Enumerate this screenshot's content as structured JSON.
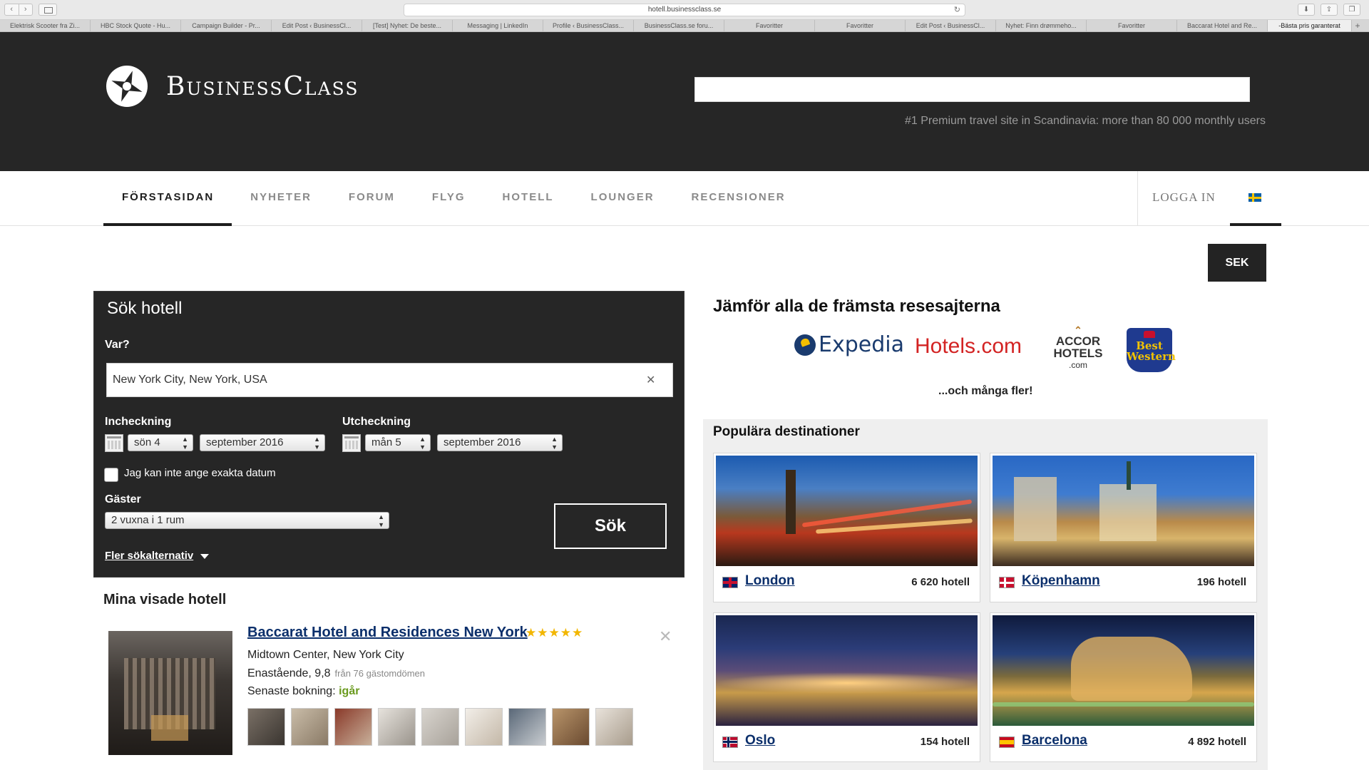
{
  "browser": {
    "url": "hotell.businessclass.se",
    "tabs": [
      "Elektrisk Scooter fra Zi...",
      "HBC Stock Quote - Hu...",
      "Campaign Builder - Pr...",
      "Edit Post ‹ BusinessCl...",
      "[Test] Nyhet: De beste...",
      "Messaging | LinkedIn",
      "Profile ‹ BusinessClass...",
      "BusinessClass.se foru...",
      "Favoritter",
      "Favoritter",
      "Edit Post ‹ BusinessCl...",
      "Nyhet: Finn drømmeho...",
      "Favoritter",
      "Baccarat Hotel and Re...",
      "-Bästa pris garanterat"
    ]
  },
  "header": {
    "logo_text": "BusinessClass",
    "tagline": "#1 Premium travel site in Scandinavia: more than 80 000 monthly users"
  },
  "nav": {
    "items": [
      "FÖRSTASIDAN",
      "NYHETER",
      "FORUM",
      "FLYG",
      "HOTELL",
      "LOUNGER",
      "RECENSIONER"
    ],
    "login": "LOGGA IN"
  },
  "currency": "SEK",
  "search": {
    "title": "Sök hotell",
    "where_label": "Var?",
    "where_value": "New York City, New York, USA",
    "checkin_label": "Incheckning",
    "checkin_day": "sön 4",
    "checkin_month": "september 2016",
    "checkout_label": "Utcheckning",
    "checkout_day": "mån 5",
    "checkout_month": "september 2016",
    "no_dates_label": "Jag kan inte ange exakta datum",
    "guests_label": "Gäster",
    "guests_value": "2 vuxna i 1 rum",
    "submit": "Sök",
    "more_options": "Fler sökalternativ"
  },
  "viewed": {
    "title": "Mina visade hotell",
    "hotel_name": "Baccarat Hotel and Residences New York",
    "stars": "★★★★★",
    "area": "Midtown Center, New York City",
    "rating_text": "Enastående, 9,8",
    "reviews_text": "från 76 gästomdömen",
    "booking_prefix": "Senaste bokning:",
    "booking_when": "igår"
  },
  "compare": {
    "title": "Jämför alla de främsta resesajterna",
    "partners": {
      "expedia": "Expedia",
      "hotelscom": "Hotels.com",
      "accor_line1": "ACCOR",
      "accor_line2": "HOTELS",
      "accor_line3": ".com",
      "bw_line1": "Best",
      "bw_line2": "Western"
    },
    "more": "...och många fler!"
  },
  "popular": {
    "title": "Populära destinationer",
    "destinations": [
      {
        "name": "London",
        "count": "6 620 hotell"
      },
      {
        "name": "Köpenhamn",
        "count": "196 hotell"
      },
      {
        "name": "Oslo",
        "count": "154 hotell"
      },
      {
        "name": "Barcelona",
        "count": "4 892 hotell"
      }
    ]
  }
}
